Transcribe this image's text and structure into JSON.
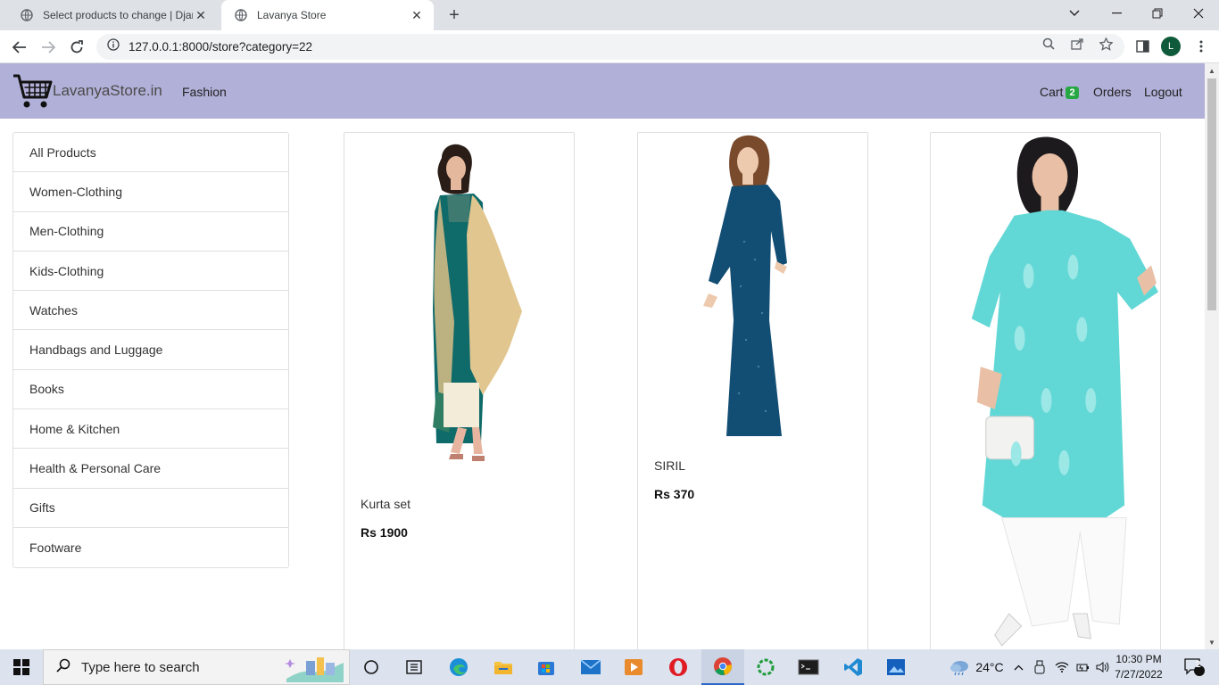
{
  "browser": {
    "tabs": [
      {
        "title": "Select products to change | Djang",
        "active": false
      },
      {
        "title": "Lavanya Store",
        "active": true
      }
    ],
    "url": "127.0.0.1:8000/store?category=22",
    "profile_initial": "L"
  },
  "site": {
    "brand": "LavanyaStore.in",
    "category_link": "Fashion",
    "cart_label": "Cart",
    "cart_count": "2",
    "orders_label": "Orders",
    "logout_label": "Logout",
    "nav_color": "#b1b0d8",
    "badge_color": "#28a745"
  },
  "categories": [
    "All Products",
    "Women-Clothing",
    "Men-Clothing",
    "Kids-Clothing",
    "Watches",
    "Handbags and Luggage",
    "Books",
    "Home & Kitchen",
    "Health & Personal Care",
    "Gifts",
    "Footware"
  ],
  "products": [
    {
      "name": "Kurta set",
      "price": "Rs 1900",
      "image_icon": "woman-green-kurta-set-image"
    },
    {
      "name": "SIRIL",
      "price": "Rs 370",
      "image_icon": "woman-blue-kurta-image"
    },
    {
      "name": "",
      "price": "",
      "image_icon": "woman-turquoise-kurta-image"
    }
  ],
  "taskbar": {
    "search_placeholder": "Type here to search",
    "weather": "24°C",
    "time": "10:30 PM",
    "date": "7/27/2022",
    "notification_count": "2"
  }
}
